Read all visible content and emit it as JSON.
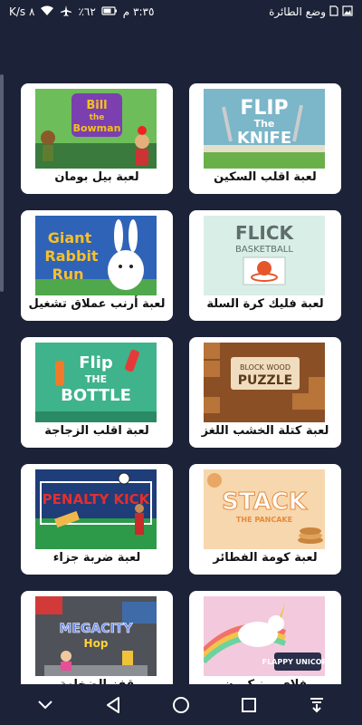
{
  "status_bar": {
    "time": "٣:٣٥ م",
    "battery": "٦٢٪",
    "network_speed": "٨ K/s",
    "airplane_mode_label": "وضع الطائرة",
    "icons": [
      "battery-icon",
      "airplane-icon",
      "wifi-icon",
      "signal-icon",
      "sim-icon",
      "image-icon"
    ]
  },
  "games": [
    {
      "label": "لعبة بيل بومان",
      "thumb_title": "Bill the Bowman",
      "bg": "#3a7a3c",
      "accent": "#f4c21a"
    },
    {
      "label": "لعبة اقلب السكين",
      "thumb_title": "FLIP The KNIFE",
      "bg": "#7bb6c9",
      "accent": "#ffffff"
    },
    {
      "label": "لعبة أرنب عملاق تشغيل",
      "thumb_title": "Giant Rabbit Run",
      "bg": "#2e63b8",
      "accent": "#f7c02a"
    },
    {
      "label": "لعبة فليك كرة السلة",
      "thumb_title": "FLICK BASKETBALL",
      "bg": "#d9eee6",
      "accent": "#5f6d6b"
    },
    {
      "label": "لعبة اقلب الزجاجة",
      "thumb_title": "Flip THE BOTTLE",
      "bg": "#3fb38b",
      "accent": "#ffffff"
    },
    {
      "label": "لعبة كتلة الخشب اللغز",
      "thumb_title": "BLOCK WOOD PUZZLE",
      "bg": "#8a4f25",
      "accent": "#f0dcbf"
    },
    {
      "label": "لعبة ضربة جزاء",
      "thumb_title": "PENALTY KICK",
      "bg": "#2d9a4a",
      "accent": "#e32f2f"
    },
    {
      "label": "لعبة كومة الفطائر",
      "thumb_title": "STACK THE PANCAKE",
      "bg": "#f7d7ad",
      "accent": "#ffffff"
    },
    {
      "label": "قفز الضخامة",
      "thumb_title": "MEGACITY Hop",
      "bg": "#4f5258",
      "accent": "#6c8ef5"
    },
    {
      "label": "فلاي يونيكورن",
      "thumb_title": "FLAPPY UNICORN",
      "bg": "#f3c9dd",
      "accent": "#ffffff"
    }
  ],
  "nav_bar": {
    "icons": [
      "chevron-down-icon",
      "back-icon",
      "home-icon",
      "recents-icon",
      "notification-pull-icon"
    ]
  },
  "colors": {
    "background": "#1c2237",
    "card": "#ffffff"
  }
}
